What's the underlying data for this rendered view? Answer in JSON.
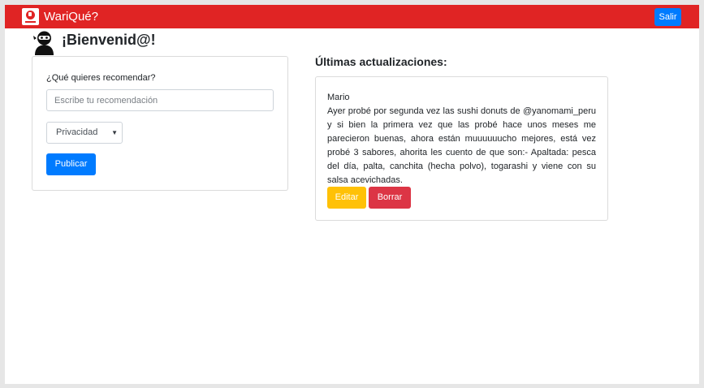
{
  "navbar": {
    "brand_text": "WariQué?",
    "logout_label": "Salir",
    "color": "#e02424"
  },
  "welcome": {
    "avatar_icon": "ninja-icon",
    "title": "¡Bienvenid@!"
  },
  "form": {
    "prompt_label": "¿Qué quieres recomendar?",
    "input_placeholder": "Escribe tu recomendación",
    "input_value": "",
    "privacy_selected": "Privacidad",
    "publish_label": "Publicar"
  },
  "updates": {
    "title": "Últimas actualizaciones:",
    "posts": [
      {
        "author": "Mario",
        "text": "Ayer probé por segunda vez las sushi donuts de @yanomami_peru y si bien la primera vez que las probé hace unos meses me parecieron buenas, ahora están muuuuuucho mejores, está vez probé 3 sabores, ahorita les cuento de que son:- Apaltada: pesca del día, palta, canchita (hecha polvo), togarashi y viene con su salsa acevichadas.",
        "edit_label": "Editar",
        "delete_label": "Borrar"
      }
    ]
  },
  "colors": {
    "primary": "#007bff",
    "warning": "#ffc107",
    "danger": "#dc3545"
  }
}
